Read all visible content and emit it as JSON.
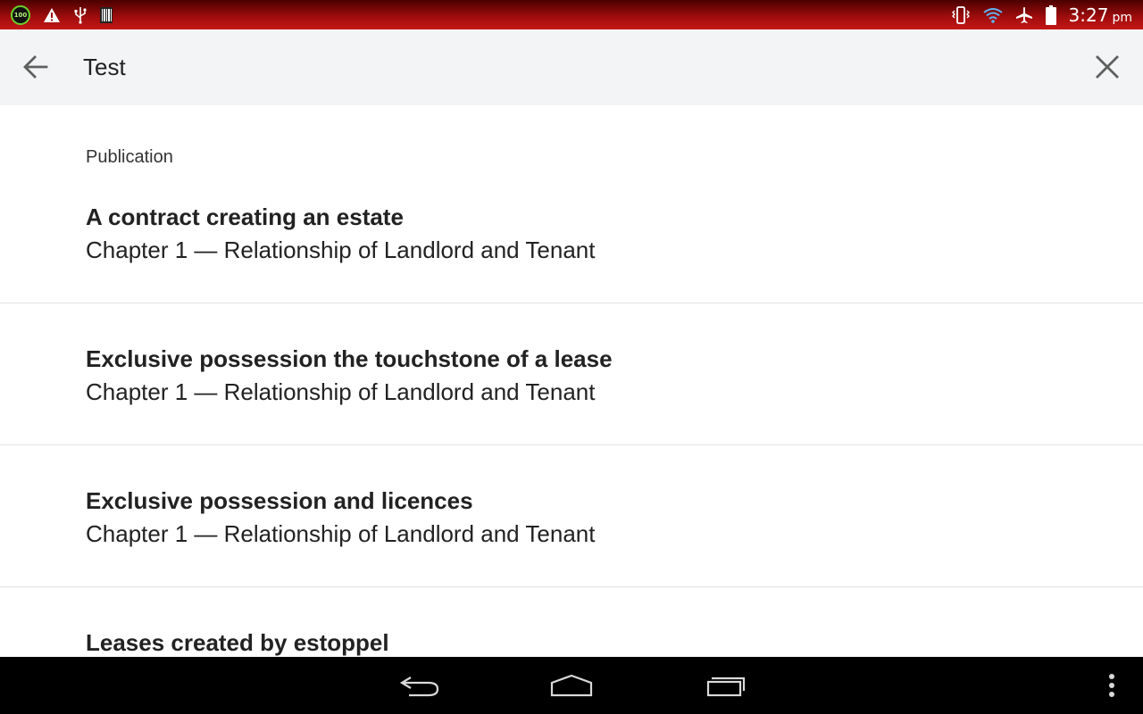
{
  "status_bar": {
    "battery_level_badge": "100",
    "time": "3:27",
    "ampm": "pm",
    "left_icons": [
      "battery-level-icon",
      "warning-icon",
      "usb-icon",
      "barcode-icon"
    ],
    "right_icons": [
      "vibrate-icon",
      "wifi-icon",
      "airplane-mode-icon",
      "battery-icon"
    ],
    "colors": {
      "bar": "#a30d0d",
      "badge_ring": "#6bd12b"
    }
  },
  "search": {
    "query": "Test",
    "back_icon": "arrow-back-icon",
    "clear_icon": "close-icon"
  },
  "results": {
    "section_header": "Publication",
    "items": [
      {
        "title": "A contract creating an estate",
        "subtitle": "Chapter 1 — Relationship of Landlord and Tenant"
      },
      {
        "title": "Exclusive possession the touchstone of a lease",
        "subtitle": "Chapter 1 — Relationship of Landlord and Tenant"
      },
      {
        "title": "Exclusive possession and licences",
        "subtitle": "Chapter 1 — Relationship of Landlord and Tenant"
      },
      {
        "title": "Leases created by estoppel",
        "subtitle": ""
      }
    ]
  },
  "nav_bar": {
    "buttons": [
      "back-nav-icon",
      "home-icon",
      "recent-apps-icon",
      "overflow-menu-icon"
    ]
  }
}
